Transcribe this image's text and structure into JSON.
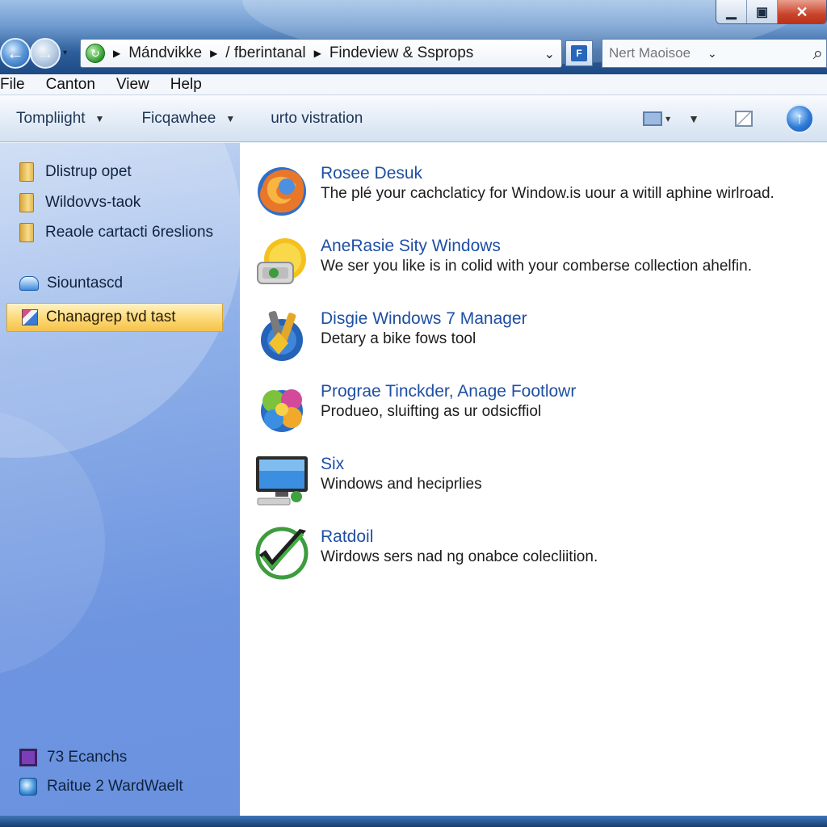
{
  "window": {
    "caption_minimize": "▁",
    "caption_maximize": "▣",
    "caption_close": "✕"
  },
  "navigation": {
    "address_crumbs": [
      "Mándvikke",
      "/ fberintanal",
      "Findeview & Ssprops"
    ],
    "search_placeholder": "Nert Maoisoe"
  },
  "menu": [
    "File",
    "Canton",
    "View",
    "Help"
  ],
  "command_bar": {
    "items": [
      "Tompliight",
      "Ficqawhee",
      "urto vistration"
    ]
  },
  "sidebar": {
    "folders": [
      "Dlistrup opet",
      "Wildovvs-taok",
      "Reaole cartacti 6reslions"
    ],
    "cloud_item": "Siountascd",
    "selected_item": "Chanagrep tvd tast",
    "bottom_items": [
      "73 Ecanchs",
      "Raitue 2 WardWaelt"
    ]
  },
  "entries": [
    {
      "icon": "firefox-icon",
      "title": "Rosee Desuk",
      "desc": "The plé your cachclaticy for Window.is uour a witill aphine wirlroad."
    },
    {
      "icon": "drive-icon",
      "title": "AneRasie Sity Windows",
      "desc": "We ser you like is in colid with your comberse collection ahelfin."
    },
    {
      "icon": "tools-icon",
      "title": "Disgie Windows 7 Manager",
      "desc": "Detary a bike fows tool"
    },
    {
      "icon": "puzzle-icon",
      "title": "Prograe Tinckder, Anage Footlowr",
      "desc": "Produeo, sluifting as ur odsicffiol"
    },
    {
      "icon": "monitor-icon",
      "title": "Six",
      "desc": "Windows and heciprlies"
    },
    {
      "icon": "checkmark-icon",
      "title": "Ratdoil",
      "desc": "Wirdows sers nad ng onabce colecliition."
    }
  ]
}
